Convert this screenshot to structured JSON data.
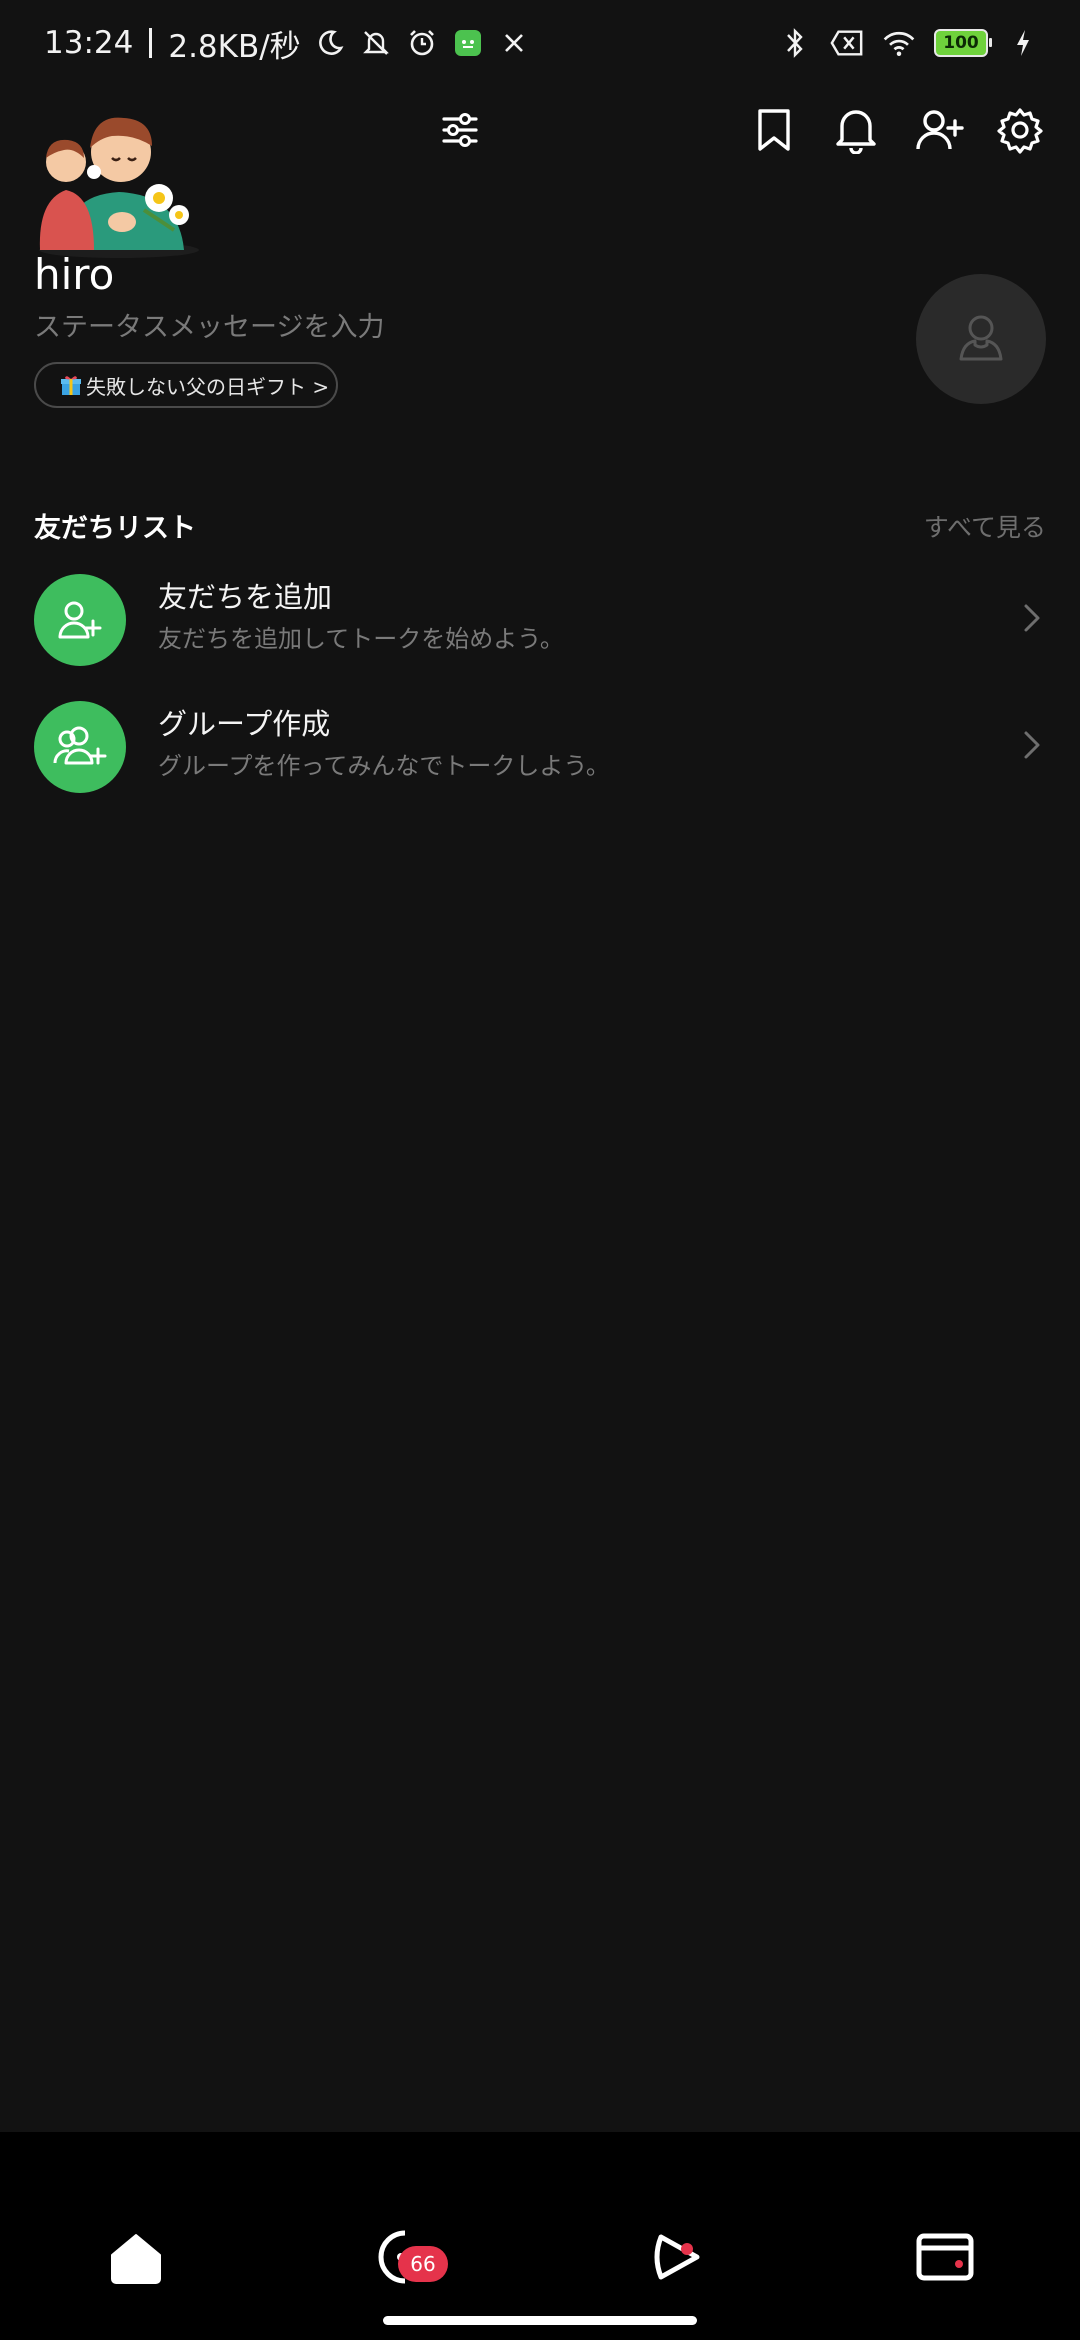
{
  "status_bar": {
    "time": "13:24",
    "speed": "2.8KB/秒",
    "battery": "100",
    "icons": [
      "moon-icon",
      "bell-off-icon",
      "alarm-icon",
      "app-icon",
      "x-icon",
      "bluetooth-icon",
      "no-sim-icon",
      "wifi-icon",
      "battery-icon",
      "charging-icon"
    ]
  },
  "toolbar": {
    "icons": [
      "sliders-icon",
      "bookmark-icon",
      "bell-icon",
      "add-friend-icon",
      "gear-icon"
    ]
  },
  "profile": {
    "name": "hiro",
    "status_placeholder": "ステータスメッセージを入力",
    "promo": "失敗しない父の日ギフト >"
  },
  "friends": {
    "title": "友だちリスト",
    "see_all": "すべて見る",
    "items": [
      {
        "title": "友だちを追加",
        "subtitle": "友だちを追加してトークを始めよう。",
        "icon": "add-friend-icon"
      },
      {
        "title": "グループ作成",
        "subtitle": "グループを作ってみんなでトークしよう。",
        "icon": "add-group-icon"
      }
    ]
  },
  "bottom_nav": {
    "items": [
      "home-icon",
      "chats-icon",
      "voom-icon",
      "wallet-icon"
    ],
    "chat_badge": "66"
  },
  "colors": {
    "accent_green": "#3ebd5e",
    "badge_red": "#e5334b",
    "background": "#121212"
  }
}
